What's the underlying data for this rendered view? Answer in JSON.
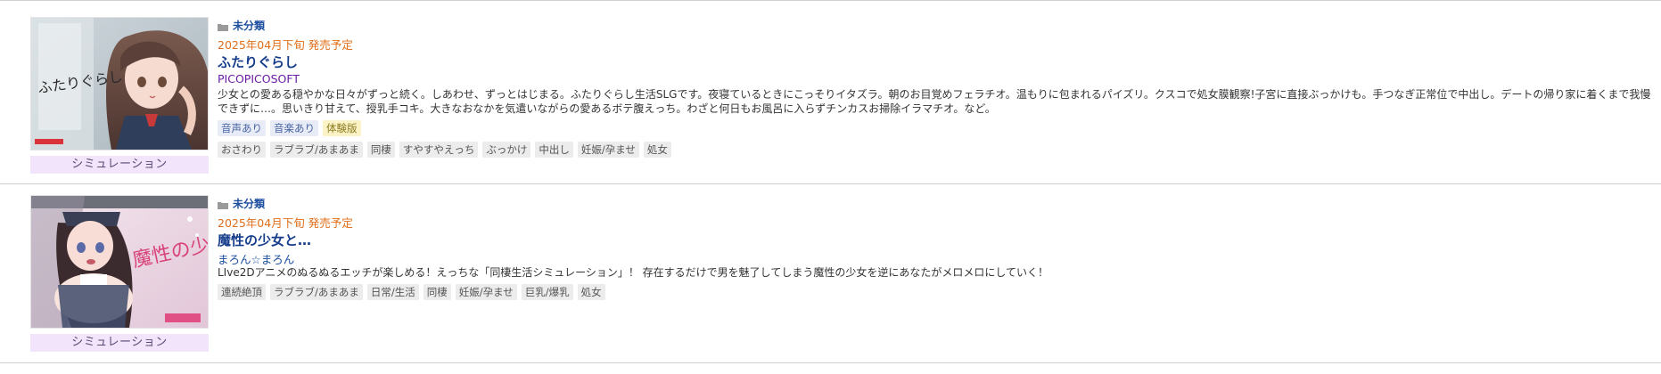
{
  "items": [
    {
      "category": "未分類",
      "release": "2025年04月下旬 発売予定",
      "title": "ふたりぐらし",
      "circle": "PICOPICOSOFT",
      "description": "少女との愛ある穏やかな日々がずっと続く。しあわせ、ずっとはじまる。ふたりぐらし生活SLGです。夜寝ているときにこっそりイタズラ。朝のお目覚めフェラチオ。温もりに包まれるパイズリ。クスコで処女膜観察!子宮に直接ぶっかけも。手つなぎ正常位で中出し。デートの帰り家に着くまで我慢できずに…。思いきり甘えて、授乳手コキ。大きなおなかを気遣いながらの愛あるボテ腹えっち。わざと何日もお風呂に入らずチンカスお掃除イラマチオ。など。",
      "thumbnail_text": "ふたりぐらし",
      "sim_label": "シミュレーション",
      "feature_tags": [
        "音声あり",
        "音楽あり",
        "体験版"
      ],
      "genre_tags": [
        "おさわり",
        "ラブラブ/あまあま",
        "同棲",
        "すやすやえっち",
        "ぶっかけ",
        "中出し",
        "妊娠/孕ませ",
        "処女"
      ]
    },
    {
      "category": "未分類",
      "release": "2025年04月下旬 発売予定",
      "title": "魔性の少女と…",
      "circle": "まろん☆まろん",
      "description": "LIve2Dアニメのぬるぬるエッチが楽しめる！えっちな「同棲生活シミュレーション」！ 存在するだけで男を魅了してしまう魔性の少女を逆にあなたがメロメロにしていく！",
      "thumbnail_text": "魔性の少女と…",
      "sim_label": "シミュレーション",
      "feature_tags": [],
      "genre_tags": [
        "連続絶頂",
        "ラブラブ/あまあま",
        "日常/生活",
        "同棲",
        "妊娠/孕ませ",
        "巨乳/爆乳",
        "処女"
      ]
    }
  ],
  "colors": {
    "category": "#1d4fa0",
    "release": "#e06e1a",
    "title": "#163d8c",
    "circle_1": "#6a1ca4",
    "circle_2": "#1d4fa0",
    "sim_label_bg": "#f1e4fb"
  },
  "icons": {
    "category": "folder-icon"
  }
}
